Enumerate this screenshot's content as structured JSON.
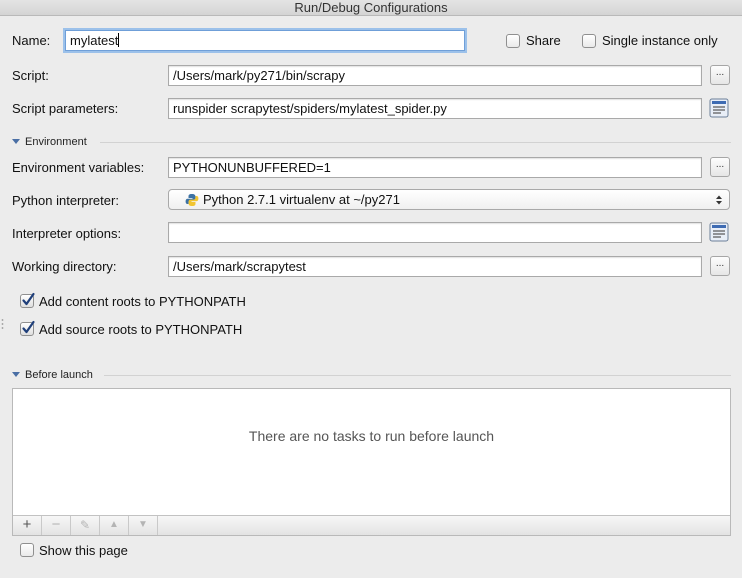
{
  "window": {
    "title": "Run/Debug Configurations"
  },
  "name_row": {
    "label": "Name:",
    "value": "mylatest",
    "share_label": "Share",
    "share_checked": false,
    "single_instance_label": "Single instance only",
    "single_instance_checked": false
  },
  "script": {
    "label": "Script:",
    "value": "/Users/mark/py271/bin/scrapy"
  },
  "script_params": {
    "label": "Script parameters:",
    "value": "runspider scrapytest/spiders/mylatest_spider.py"
  },
  "environment": {
    "section_label": "Environment",
    "env_vars": {
      "label": "Environment variables:",
      "value": "PYTHONUNBUFFERED=1"
    },
    "interpreter": {
      "label": "Python interpreter:",
      "value": "Python 2.7.1 virtualenv at ~/py271"
    },
    "interpreter_options": {
      "label": "Interpreter options:",
      "value": ""
    },
    "working_dir": {
      "label": "Working directory:",
      "value": "/Users/mark/scrapytest"
    },
    "add_content_roots": {
      "label": "Add content roots to PYTHONPATH",
      "checked": true
    },
    "add_source_roots": {
      "label": "Add source roots to PYTHONPATH",
      "checked": true
    }
  },
  "before_launch": {
    "section_label": "Before launch",
    "empty_message": "There are no tasks to run before launch",
    "toolbar": {
      "add": "+",
      "remove": "−",
      "edit": "✎",
      "up": "▲",
      "down": "▼"
    }
  },
  "show_page": {
    "label": "Show this page",
    "checked": false
  },
  "browse_label": "...",
  "colors": {
    "focus": "#6f9fd8",
    "accent": "#4a6fa5",
    "check": "#1f3f7a"
  }
}
